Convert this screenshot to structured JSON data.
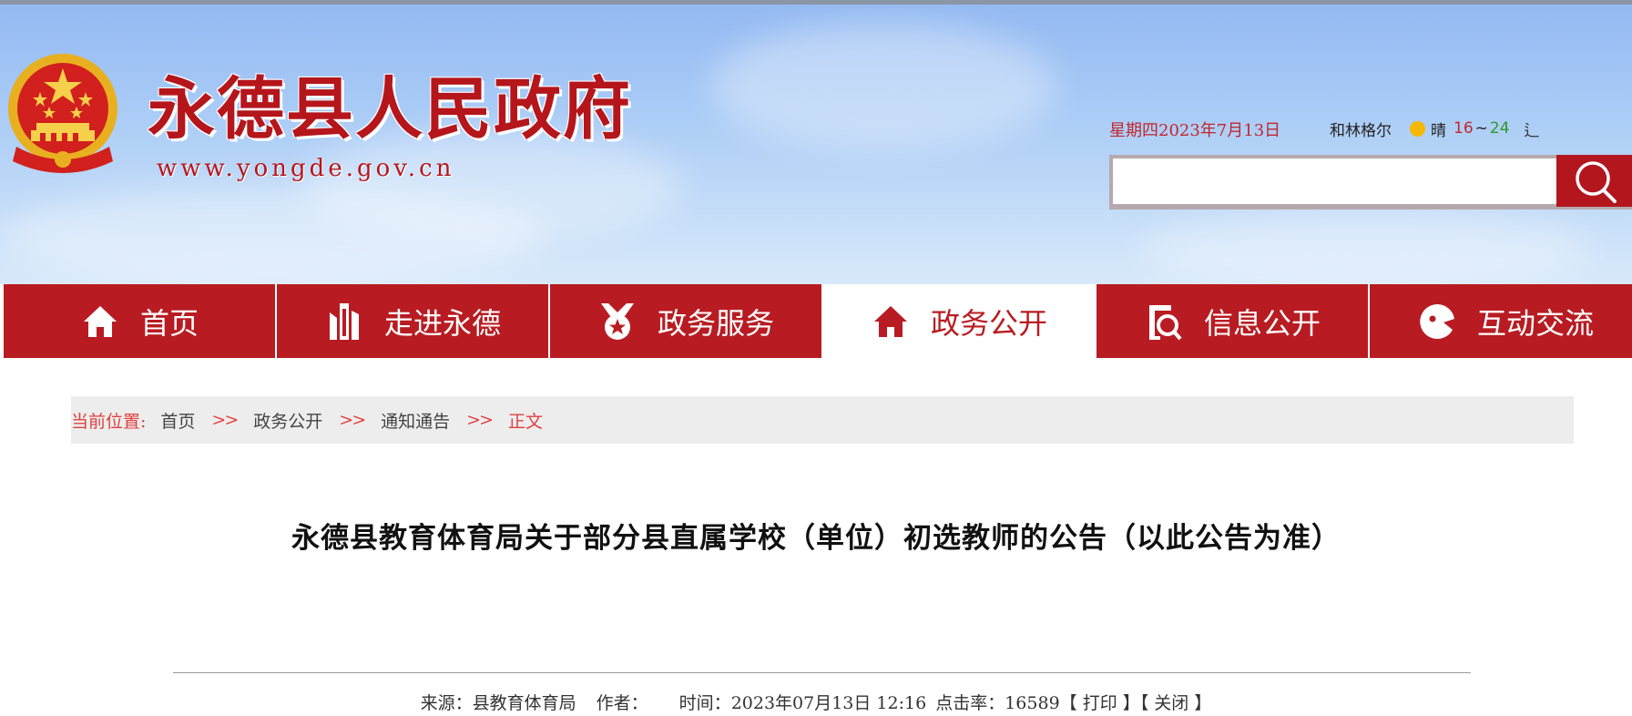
{
  "header": {
    "site_title": "永德县人民政府",
    "site_url": "www.yongde.gov.cn",
    "date_text": "星期四2023年7月13日",
    "weather": {
      "city": "和林格尔",
      "condition": "晴",
      "temp_low": "16",
      "temp_sep": "~",
      "temp_high": "24",
      "more_glyph": "⻍"
    },
    "search": {
      "value": "",
      "placeholder": ""
    }
  },
  "nav": {
    "items": [
      {
        "label": "首页",
        "icon": "home-icon"
      },
      {
        "label": "走进永德",
        "icon": "building-icon"
      },
      {
        "label": "政务服务",
        "icon": "medal-icon"
      },
      {
        "label": "政务公开",
        "icon": "home-icon",
        "active": true
      },
      {
        "label": "信息公开",
        "icon": "document-search-icon"
      },
      {
        "label": "互动交流",
        "icon": "chat-icon"
      }
    ]
  },
  "breadcrumb": {
    "label": "当前位置:",
    "sep": ">>",
    "items": [
      "首页",
      "政务公开",
      "通知通告"
    ],
    "current": "正文"
  },
  "article": {
    "title": "永德县教育体育局关于部分县直属学校（单位）初选教师的公告（以此公告为准）",
    "meta": {
      "source_label": "来源：",
      "source": "县教育体育局",
      "author_label": "作者：",
      "author": "",
      "time_label": "时间：",
      "time": "2023年07月13日 12:16",
      "hits_label": "点击率：",
      "hits": "16589",
      "print": "【 打印 】",
      "close": "【 关闭 】"
    }
  },
  "colors": {
    "brand_red": "#b81c22",
    "header_blue": "#a9cbf6",
    "breadcrumb_red": "#e0403f"
  }
}
